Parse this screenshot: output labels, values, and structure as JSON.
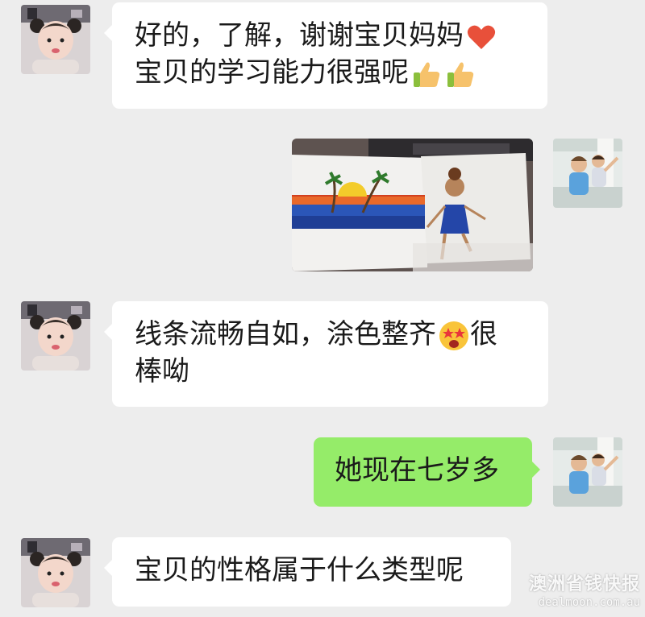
{
  "messages": [
    {
      "side": "left",
      "lines": [
        "好的，了解，谢谢宝贝妈妈",
        "宝贝的学习能力很强呢"
      ],
      "emojis": [
        "heart-emoji",
        "thumbs-up-emoji",
        "thumbs-up-emoji"
      ]
    },
    {
      "side": "right",
      "type": "image",
      "image_desc": "children-drawings-photo"
    },
    {
      "side": "left",
      "lines": [
        "线条流畅自如，涂色整齐",
        "很",
        "棒呦"
      ],
      "emojis": [
        "starstruck-face-emoji"
      ]
    },
    {
      "side": "right",
      "lines": [
        "她现在七岁多"
      ]
    },
    {
      "side": "left",
      "lines": [
        "宝贝的性格属于什么类型呢"
      ]
    }
  ],
  "watermark": {
    "title": "澳洲省钱快报",
    "url": "dealmoon.com.au"
  },
  "colors": {
    "background": "#ededed",
    "left_bubble": "#ffffff",
    "right_bubble": "#95ec69"
  }
}
